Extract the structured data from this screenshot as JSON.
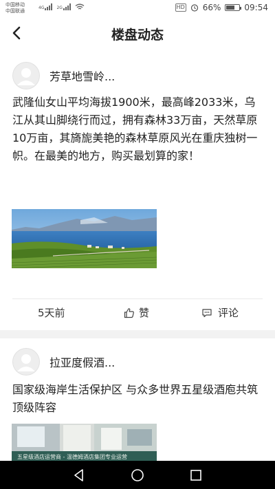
{
  "status_bar": {
    "carrier1": "中国移动",
    "carrier2": "中国联通",
    "net1": "4G",
    "net2": "2G",
    "hd": "HD",
    "battery": "66%",
    "battery_level": 0.66,
    "time": "09:54"
  },
  "header": {
    "title": "楼盘动态",
    "back_icon": "back-arrow-icon"
  },
  "posts": [
    {
      "author": "芳草地雪岭...",
      "content": "武隆仙女山平均海拔1900米，最高峰2033米，乌江从其山脚绕行而过，拥有森林33万亩，天然草原10万亩，其旖旎美艳的森林草原风光在重庆独树一帜。在最美的地方，购买最划算的家！",
      "time": "5天前",
      "like_label": "赞",
      "comment_label": "评论"
    },
    {
      "author": "拉亚度假酒...",
      "content": "国家级海岸生活保护区 与众多世界五星级酒庖共筑顶级阵容",
      "image_caption": "五星级酒店运营商 - 温德姆酒店集团专业运营"
    }
  ],
  "colors": {
    "divider": "#f2f2f2",
    "navbar": "#000000"
  }
}
